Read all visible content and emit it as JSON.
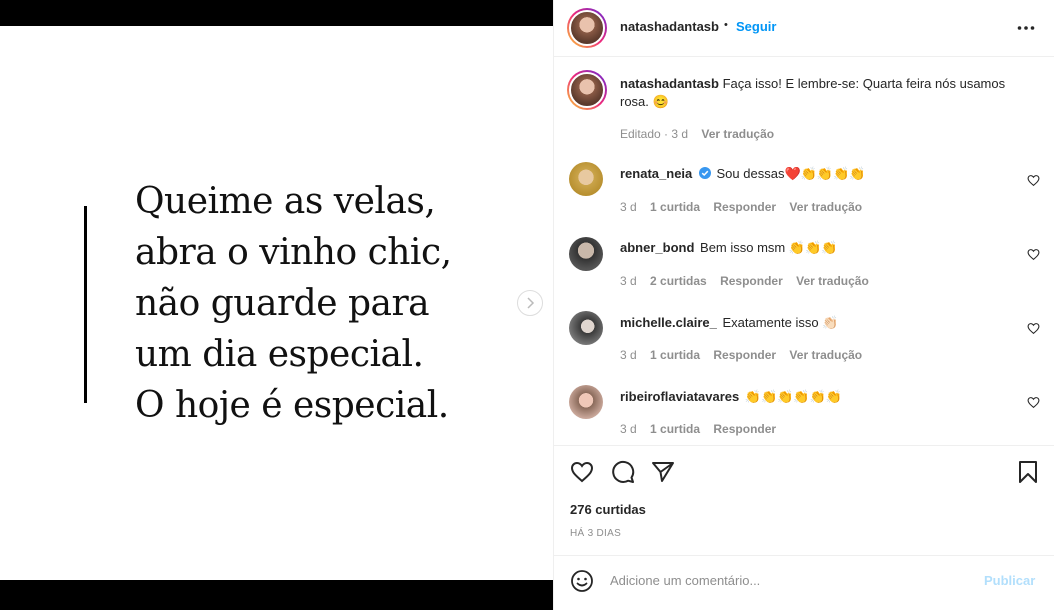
{
  "header": {
    "username": "natashadantasb",
    "separator": "•",
    "follow_label": "Seguir",
    "more_label": "•••"
  },
  "media": {
    "quote_lines": [
      "Queime as velas,",
      "abra o vinho chic,",
      "não guarde para",
      "um dia especial.",
      "O hoje é especial."
    ],
    "next_glyph": "›"
  },
  "caption": {
    "username": "natashadantasb",
    "text": "Faça isso! E lembre-se: Quarta feira nós usamos rosa. 😊",
    "edited": "Editado · 3 d",
    "translate": "Ver tradução"
  },
  "comments": [
    {
      "username": "renata_neia",
      "verified": true,
      "text": "Sou dessas❤️👏👏👏👏",
      "time": "3 d",
      "likes": "1 curtida",
      "reply": "Responder",
      "translate": "Ver tradução"
    },
    {
      "username": "abner_bond",
      "verified": false,
      "text": "Bem isso msm 👏👏👏",
      "time": "3 d",
      "likes": "2 curtidas",
      "reply": "Responder",
      "translate": "Ver tradução"
    },
    {
      "username": "michelle.claire_",
      "verified": false,
      "text": "Exatamente isso 👏🏻",
      "time": "3 d",
      "likes": "1 curtida",
      "reply": "Responder",
      "translate": "Ver tradução"
    },
    {
      "username": "ribeiroflaviatavares",
      "verified": false,
      "text": "👏👏👏👏👏👏",
      "time": "3 d",
      "likes": "1 curtida",
      "reply": "Responder",
      "translate": ""
    }
  ],
  "actions": {
    "likes_count": "276 curtidas",
    "date": "HÁ 3 DIAS"
  },
  "comment_box": {
    "placeholder": "Adicione um comentário...",
    "publish_label": "Publicar"
  },
  "colors": {
    "accent": "#0095f6",
    "accent_disabled": "#b2dffc",
    "muted": "#8e8e8e",
    "text": "#262626",
    "verified": "#3897f0"
  }
}
